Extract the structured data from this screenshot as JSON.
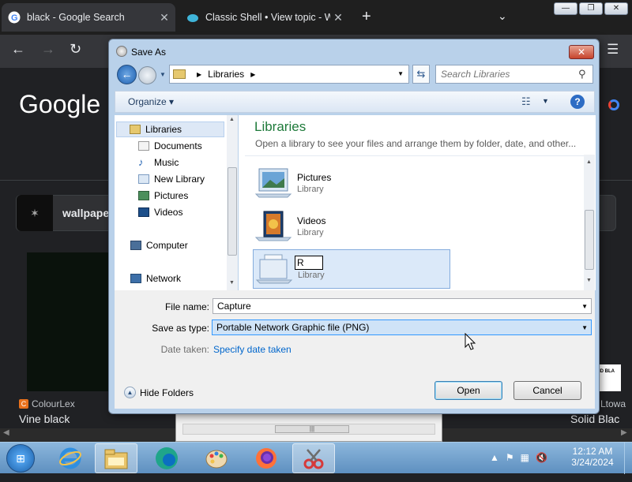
{
  "browser": {
    "tabs": [
      {
        "label": "black - Google Search",
        "active": true,
        "favicon": "google-g-icon"
      },
      {
        "label": "Classic Shell • View topic - Winc",
        "active": false,
        "favicon": "classic-shell-icon"
      }
    ],
    "new_tab_icon": "+",
    "tab_list_icon": "⌄",
    "logo": "Google",
    "chip_label": "wallpape",
    "result_left_source": "ColourLex",
    "result_left_source_icon": "C",
    "result_left_title": "Vine black",
    "result_right_source": "Ltowa",
    "result_right_title": "Solid Blac",
    "thumb_right_text": "ID BLA"
  },
  "window_controls": {
    "minimize": "—",
    "maximize": "❐",
    "close": "✕"
  },
  "dialog": {
    "title": "Save As",
    "address_path": "Libraries",
    "search_placeholder": "Search Libraries",
    "organize_label": "Organize",
    "nav_items": [
      "Libraries",
      "Documents",
      "Music",
      "New Library",
      "Pictures",
      "Videos",
      "Computer",
      "Network"
    ],
    "content_title": "Libraries",
    "content_desc": "Open a library to see your files and arrange them by folder, date, and other...",
    "libraries": [
      {
        "name": "Pictures",
        "kind": "Library"
      },
      {
        "name": "Videos",
        "kind": "Library"
      },
      {
        "name": "",
        "kind": "Library",
        "rename_value": "R"
      }
    ],
    "file_name_label": "File name:",
    "file_name_value": "Capture",
    "save_type_label": "Save as type:",
    "save_type_value": "Portable Network Graphic file (PNG)",
    "date_taken_label": "Date taken:",
    "date_taken_link": "Specify date taken",
    "hide_folders_label": "Hide Folders",
    "open_label": "Open",
    "cancel_label": "Cancel"
  },
  "taskbar": {
    "clock_time": "12:12 AM",
    "clock_date": "3/24/2024",
    "apps": [
      "internet-explorer-icon",
      "file-explorer-icon",
      "edge-icon",
      "paint-icon",
      "firefox-icon",
      "snipping-tool-icon"
    ]
  },
  "colors": {
    "dialog_frame": "#b9d1ea",
    "library_title": "#1e7a3a",
    "link": "#0066cc",
    "browser_bg": "#202124"
  }
}
